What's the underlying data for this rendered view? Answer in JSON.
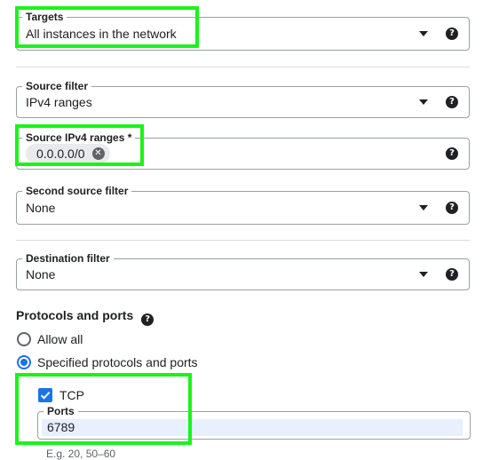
{
  "targets": {
    "label": "Targets",
    "value": "All instances in the network"
  },
  "source_filter": {
    "label": "Source filter",
    "value": "IPv4 ranges"
  },
  "source_ranges": {
    "label": "Source IPv4 ranges *",
    "chips": [
      "0.0.0.0/0"
    ]
  },
  "second_source_filter": {
    "label": "Second source filter",
    "value": "None"
  },
  "destination_filter": {
    "label": "Destination filter",
    "value": "None"
  },
  "protocols": {
    "title": "Protocols and ports",
    "options": [
      "Allow all",
      "Specified protocols and ports"
    ],
    "selected": "Specified protocols and ports",
    "tcp": {
      "label": "TCP",
      "checked": true,
      "ports_label": "Ports",
      "ports_value": "6789",
      "ports_hint": "E.g. 20, 50–60"
    }
  },
  "help_icon_glyph": "?",
  "accent_color": "#1a73e8",
  "highlight_color": "#19f41a"
}
